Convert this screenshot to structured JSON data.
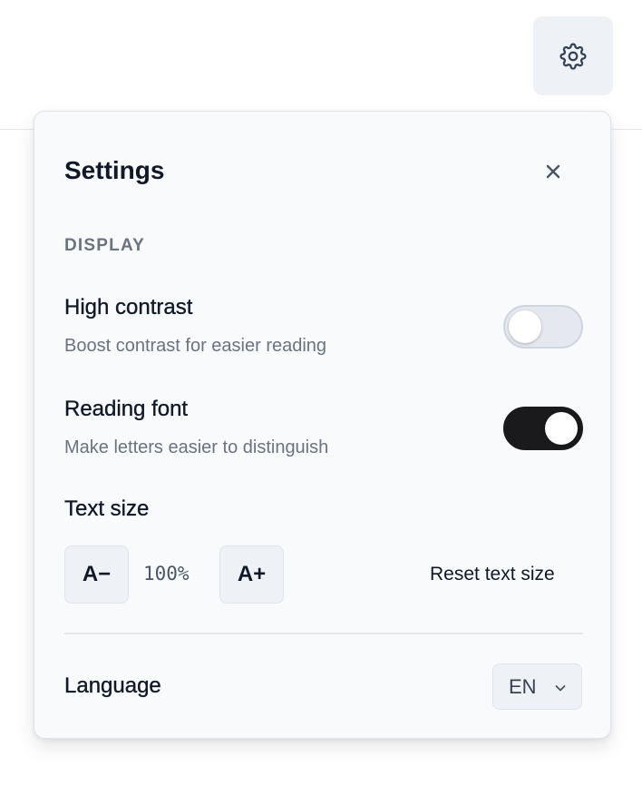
{
  "header": {
    "settings_button_icon": "gear-icon"
  },
  "settings_panel": {
    "title": "Settings",
    "close_icon": "close-icon",
    "display_section": {
      "label": "DISPLAY",
      "high_contrast": {
        "title": "High contrast",
        "description": "Boost contrast for easier reading",
        "enabled": false
      },
      "reading_font": {
        "title": "Reading font",
        "description": "Make letters easier to distinguish",
        "enabled": true
      }
    },
    "text_size": {
      "title": "Text size",
      "decrease_label": "A−",
      "value": "100%",
      "increase_label": "A+",
      "reset_label": "Reset text size"
    },
    "language": {
      "title": "Language",
      "selected": "EN",
      "chevron_icon": "chevron-down-icon"
    }
  },
  "colors": {
    "toggle_on": "#1a1a1d",
    "toggle_off": "#e5e9ef",
    "panel_bg": "#f8fafc",
    "muted_text": "#6b7280"
  }
}
